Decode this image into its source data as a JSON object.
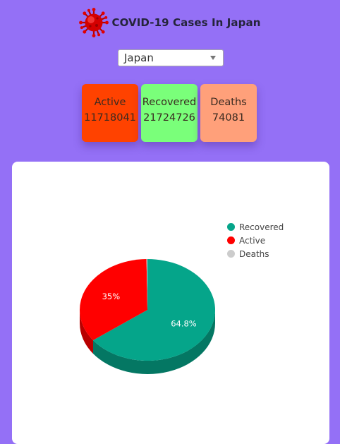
{
  "header": {
    "title": "COVID-19 Cases In Japan",
    "icon": "virus-icon"
  },
  "country_select": {
    "selected": "Japan"
  },
  "stats": {
    "active": {
      "label": "Active",
      "value": "11718041",
      "color": "#ff4200"
    },
    "recovered": {
      "label": "Recovered",
      "value": "21724726",
      "color": "#7aff7a"
    },
    "deaths": {
      "label": "Deaths",
      "value": "74081",
      "color": "#ffa07a"
    }
  },
  "chart_data": {
    "type": "pie",
    "categories": [
      "Recovered",
      "Active",
      "Deaths"
    ],
    "values": [
      21724726,
      11718041,
      74081
    ],
    "data_labels": [
      "64.8%",
      "35%",
      ""
    ],
    "colors": [
      "#05a58a",
      "#ff0000",
      "#cccccc"
    ],
    "legend_position": "top-right",
    "style": "3d"
  }
}
